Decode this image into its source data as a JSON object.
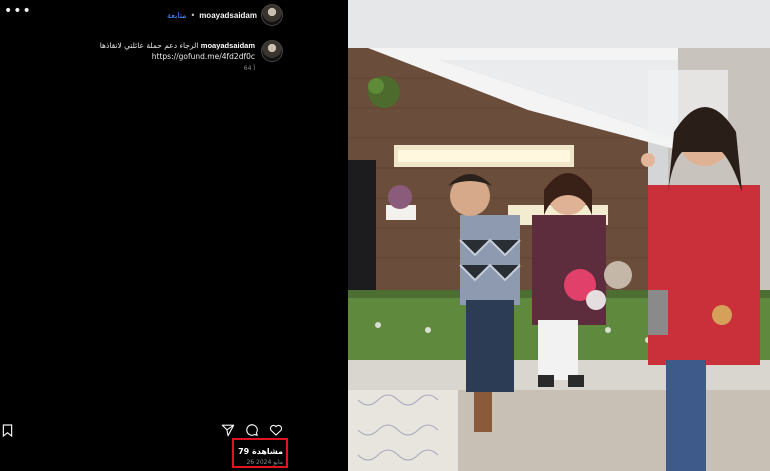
{
  "post": {
    "username": "moayadsaidam",
    "separator": "•",
    "follow_label": "متابعة",
    "caption_username": "moayadsaidam",
    "caption_text": "الرجاء دعم حملة عائلتي لانقاذها",
    "caption_link": "https://gofund.me/4fd2df0c",
    "caption_time": "64 أ",
    "views": "79 مشاهدة",
    "date": "26 مايو 2024"
  },
  "colors": {
    "accent_blue": "#4c8dff",
    "highlight_red": "#e0141f",
    "background": "#000000"
  },
  "icons": {
    "more": "more-options-icon",
    "like": "heart-icon",
    "comment": "comment-icon",
    "share": "send-icon",
    "save": "bookmark-icon"
  }
}
